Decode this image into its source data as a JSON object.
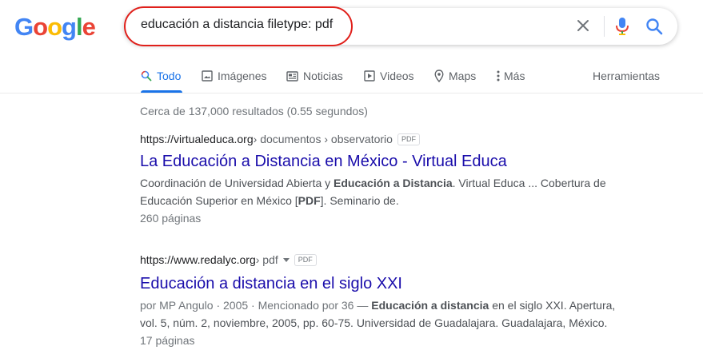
{
  "logo": {
    "letters": [
      "G",
      "o",
      "o",
      "g",
      "l",
      "e"
    ],
    "colors": [
      "#4285f4",
      "#ea4335",
      "#fbbc05",
      "#4285f4",
      "#34a853",
      "#ea4335"
    ]
  },
  "search": {
    "query": "educación a distancia filetype: pdf"
  },
  "tabs": [
    {
      "label": "Todo",
      "icon": "search-icon",
      "active": true
    },
    {
      "label": "Imágenes",
      "icon": "image-icon"
    },
    {
      "label": "Noticias",
      "icon": "news-icon"
    },
    {
      "label": "Videos",
      "icon": "video-icon"
    },
    {
      "label": "Maps",
      "icon": "map-pin-icon"
    },
    {
      "label": "Más",
      "icon": "more-vert-icon"
    }
  ],
  "tools_label": "Herramientas",
  "stats": "Cerca de 137,000 resultados (0.55 segundos)",
  "results": [
    {
      "site": "https://virtualeduca.org",
      "path": " › documentos › observatorio",
      "badge": "PDF",
      "title": "La Educación a Distancia en México - Virtual Educa",
      "snippet_parts": [
        "Coordinación de Universidad Abierta y ",
        "Educación a Distancia",
        ". Virtual Educa ... Cobertura de Educación Superior en México [",
        "PDF",
        "]. Seminario de."
      ],
      "meta": "260 páginas"
    },
    {
      "site": "https://www.redalyc.org",
      "path": " › pdf",
      "badge": "PDF",
      "title": "Educación a distancia en el siglo XXI",
      "snippet_parts": [
        "por MP Angulo · 2005 · Mencionado por 36 — ",
        "Educación a distancia",
        " en el siglo XXI. Apertura, vol. 5, núm. 2, noviembre, 2005, pp. 60-75. Universidad de Guadalajara. Guadalajara, México."
      ],
      "meta": "17 páginas"
    }
  ],
  "colors": {
    "link": "#1a0dab",
    "accent": "#1a73e8",
    "annotation": "#e0201b"
  }
}
